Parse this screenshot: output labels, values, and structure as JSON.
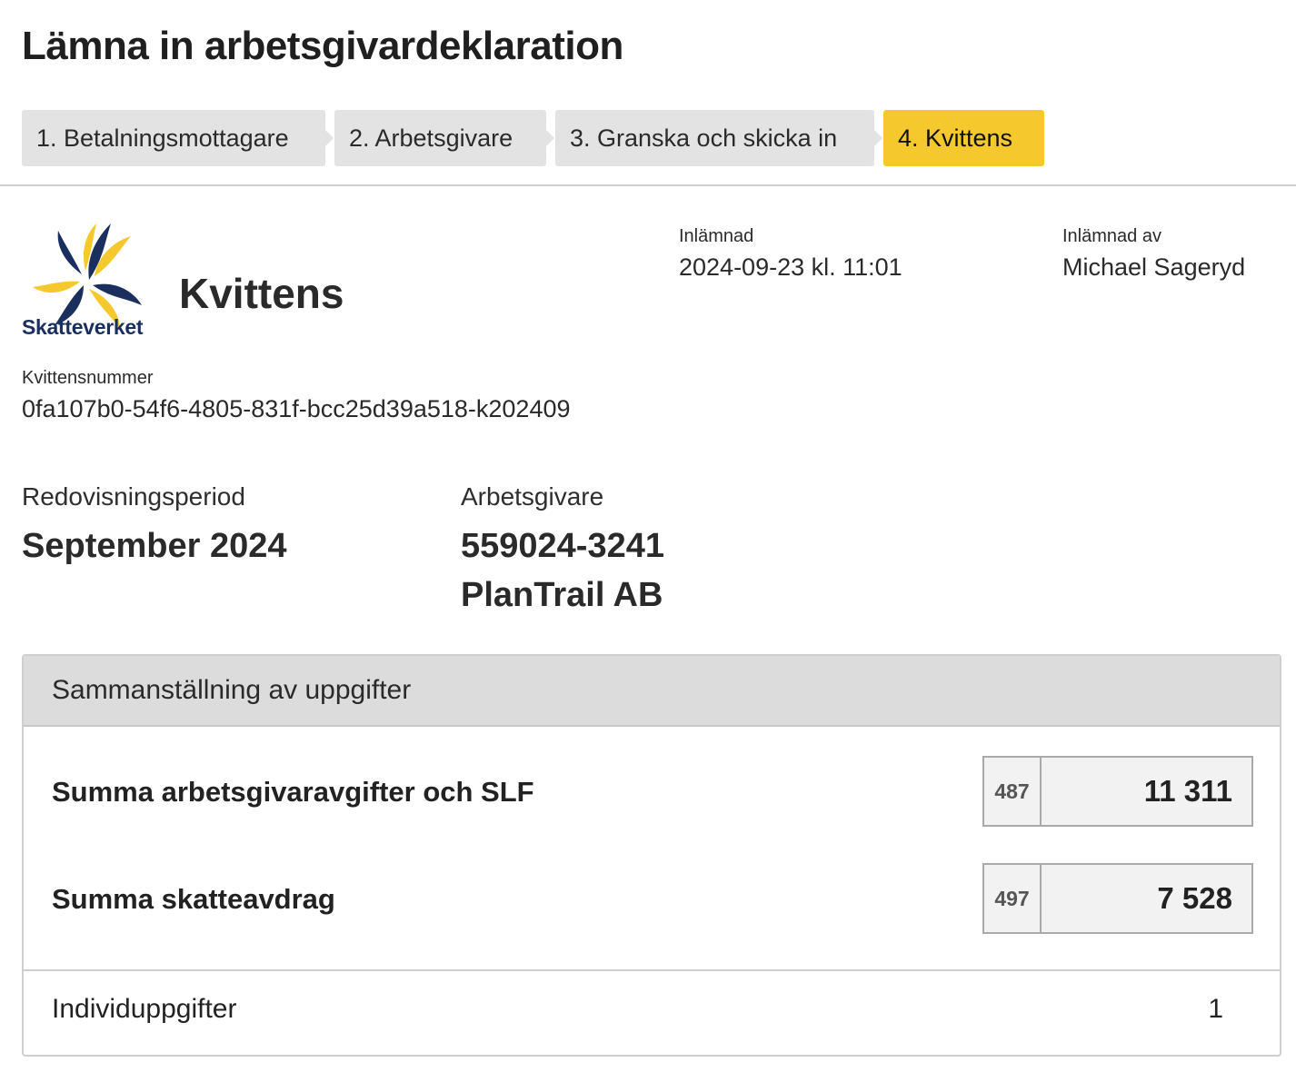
{
  "page": {
    "title": "Lämna in arbetsgivardeklaration"
  },
  "steps": [
    {
      "label": "1. Betalningsmottagare",
      "active": false
    },
    {
      "label": "2. Arbetsgivare",
      "active": false
    },
    {
      "label": "3. Granska och skicka in",
      "active": false
    },
    {
      "label": "4. Kvittens",
      "active": true
    }
  ],
  "colors": {
    "active_step": "#f5c92e",
    "inactive_step": "#e3e3e3",
    "logo_navy": "#1b2f5e",
    "logo_yellow": "#f5c92e"
  },
  "logo": {
    "name": "skatteverket-logo",
    "text": "Skatteverket"
  },
  "receipt": {
    "heading": "Kvittens",
    "submitted_label": "Inlämnad",
    "submitted_value": "2024-09-23 kl. 11:01",
    "submitted_by_label": "Inlämnad av",
    "submitted_by_value": "Michael Sageryd",
    "number_label": "Kvittensnummer",
    "number_value": "0fa107b0-54f6-4805-831f-bcc25d39a518-k202409"
  },
  "period": {
    "label": "Redovisningsperiod",
    "value": "September 2024"
  },
  "employer": {
    "label": "Arbetsgivare",
    "org_number": "559024-3241",
    "name": "PlanTrail AB"
  },
  "summary": {
    "title": "Sammanställning av uppgifter",
    "rows": [
      {
        "label": "Summa arbetsgivaravgifter och SLF",
        "code": "487",
        "value": "11 311"
      },
      {
        "label": "Summa skatteavdrag",
        "code": "497",
        "value": "7 528"
      }
    ],
    "individual": {
      "label": "Individuppgifter",
      "value": "1"
    }
  }
}
